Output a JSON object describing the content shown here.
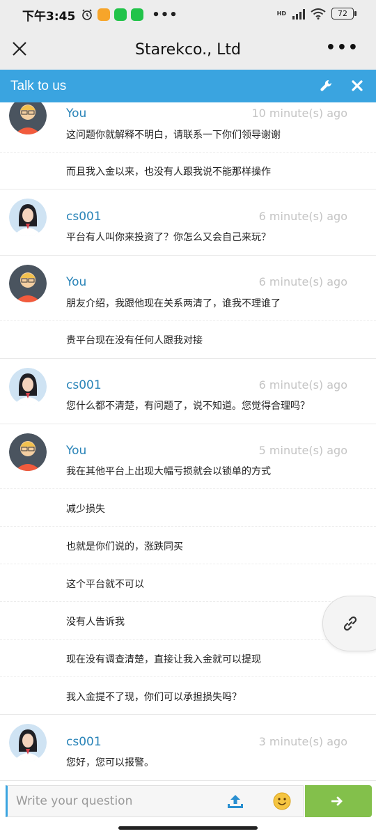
{
  "status_bar": {
    "time": "下午3:45",
    "battery": "72",
    "network": "HD"
  },
  "app_bar": {
    "title": "Starekco., Ltd"
  },
  "chat_header": {
    "title": "Talk to us"
  },
  "messages": [
    {
      "sender": "You",
      "time": "10 minute(s) ago",
      "lines": [
        "这问题你就解释不明白，请联系一下你们领导谢谢",
        "而且我入金以来，也没有人跟我说不能那样操作"
      ]
    },
    {
      "sender": "cs001",
      "time": "6 minute(s) ago",
      "lines": [
        "平台有人叫你来投资了？你怎么又会自己来玩？"
      ]
    },
    {
      "sender": "You",
      "time": "6 minute(s) ago",
      "lines": [
        "朋友介绍，我跟他现在关系两清了，谁我不理谁了",
        "贵平台现在没有任何人跟我对接"
      ]
    },
    {
      "sender": "cs001",
      "time": "6 minute(s) ago",
      "lines": [
        "您什么都不清楚，有问题了，说不知道。您觉得合理吗？"
      ]
    },
    {
      "sender": "You",
      "time": "5 minute(s) ago",
      "lines": [
        "我在其他平台上出现大幅亏损就会以锁单的方式",
        "减少损失",
        "也就是你们说的，涨跌同买",
        "这个平台就不可以",
        "没有人告诉我",
        "现在没有调查清楚，直接让我入金就可以提现",
        "我入金提不了现，你们可以承担损失吗？"
      ]
    },
    {
      "sender": "cs001",
      "time": "3 minute(s) ago",
      "lines": [
        "您好，您可以报警。"
      ]
    }
  ],
  "input": {
    "placeholder": "Write your question"
  },
  "colors": {
    "header": "#3aa4e0",
    "send": "#83c04b",
    "sender": "#2a84b8",
    "time": "#c4c4c4"
  },
  "icons": [
    "close-icon",
    "more-icon",
    "wrench-icon",
    "x-icon",
    "link-icon",
    "upload-icon",
    "emoji-icon",
    "arrow-right-icon"
  ]
}
